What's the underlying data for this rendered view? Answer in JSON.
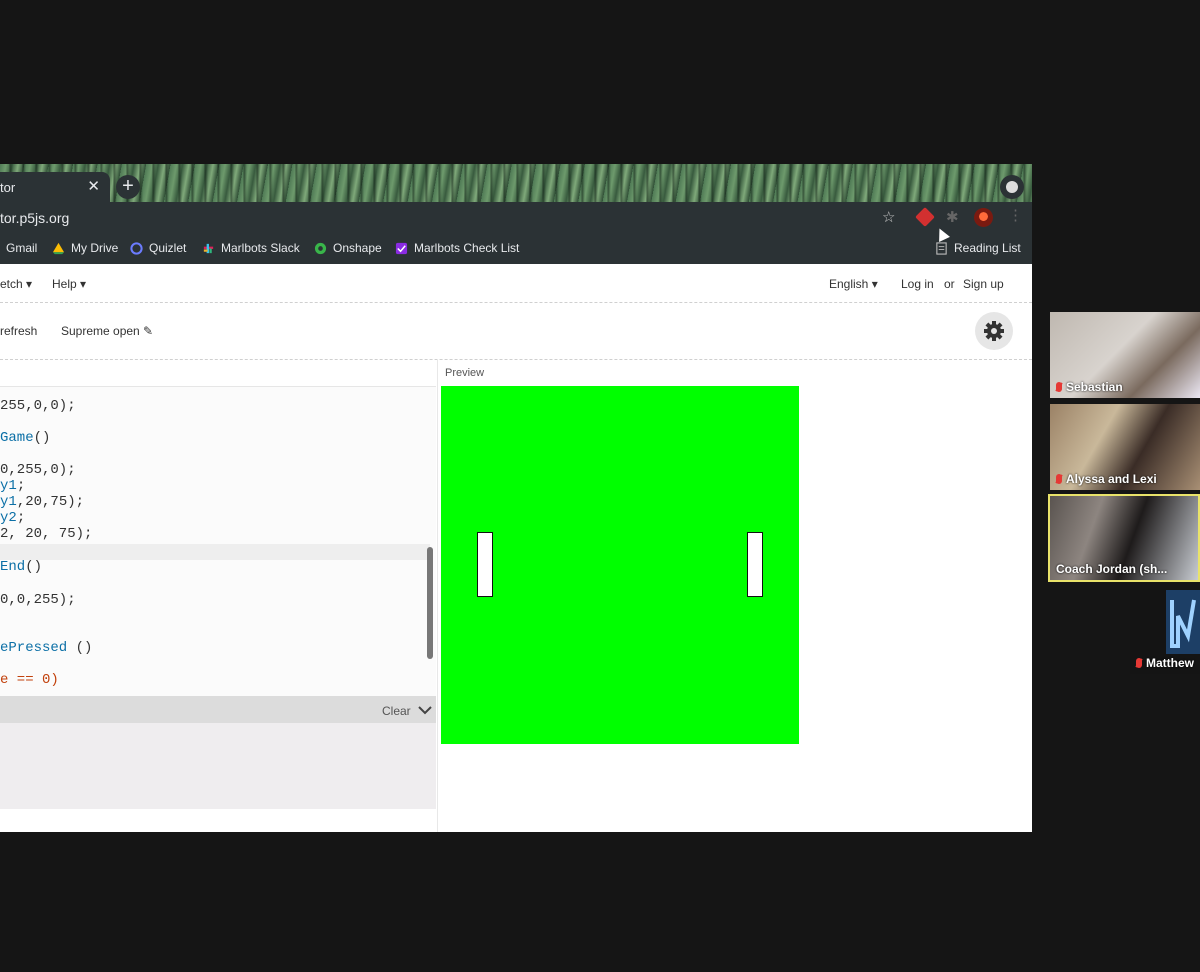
{
  "browser": {
    "tab_title": "tor",
    "tab_close": "✕",
    "new_tab": "+",
    "url": "tor.p5js.org",
    "bookmarks": [
      {
        "label": "Gmail",
        "icon": "gmail-icon",
        "color": "#ea4335"
      },
      {
        "label": "My Drive",
        "icon": "google-drive-icon",
        "color": "#fbbc04"
      },
      {
        "label": "Quizlet",
        "icon": "quizlet-icon",
        "color": "#4257b2"
      },
      {
        "label": "Marlbots Slack",
        "icon": "slack-icon",
        "color": "#e01e5a"
      },
      {
        "label": "Onshape",
        "icon": "onshape-icon",
        "color": "#39b54a"
      },
      {
        "label": "Marlbots Check List",
        "icon": "checklist-icon",
        "color": "#8a2be2"
      }
    ],
    "reading_list": "Reading List"
  },
  "editor": {
    "menu": {
      "sketch": "etch ▾",
      "help": "Help ▾",
      "language": "English ▾",
      "login": "Log in",
      "or": "or",
      "signup": "Sign up"
    },
    "auto_refresh": "refresh",
    "project_name": "Supreme open ✎",
    "preview_label": "Preview",
    "console_clear": "Clear",
    "code_lines": [
      {
        "pre": "255,0,0);",
        "kw": "",
        "post": ""
      },
      {
        "pre": "",
        "kw": "Game",
        "post": "()"
      },
      {
        "pre": "0,255,0);",
        "kw": "",
        "post": ""
      },
      {
        "pre": "",
        "kw": "y1",
        "post": ";"
      },
      {
        "pre": "",
        "kw": "y1",
        "post": ",20,75);"
      },
      {
        "pre": "",
        "kw": "y2",
        "post": ";"
      },
      {
        "pre": "2, 20, 75);",
        "kw": "",
        "post": ""
      },
      {
        "pre": "",
        "kw": "End",
        "post": "()"
      },
      {
        "pre": "0,0,255);",
        "kw": "",
        "post": ""
      },
      {
        "pre": "",
        "kw": "ePressed",
        "post": " ()"
      },
      {
        "pre": "",
        "kw": "",
        "post": ""
      }
    ],
    "code_tail": "e == 0)"
  },
  "participants": [
    {
      "name": "Sebastian",
      "muted": true
    },
    {
      "name": "Alyssa and Lexi",
      "muted": true
    },
    {
      "name": "Coach Jordan (sh...",
      "muted": false,
      "active": true
    },
    {
      "name": "Matthew",
      "muted": true
    }
  ]
}
